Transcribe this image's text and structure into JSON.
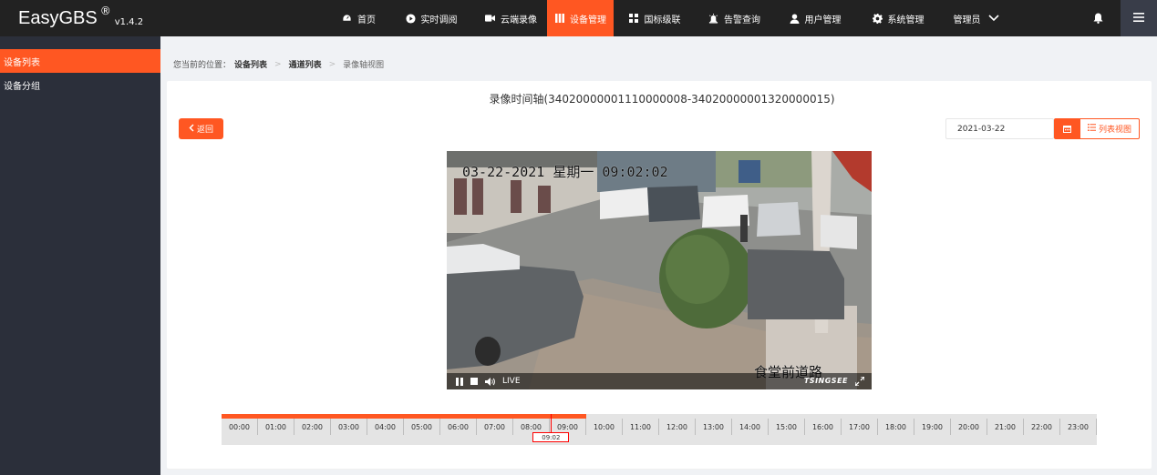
{
  "app": {
    "name": "EasyGBS",
    "reg": "®",
    "version": "v1.4.2"
  },
  "nav": [
    {
      "label": "首页",
      "icon": "dashboard-icon",
      "active": false
    },
    {
      "label": "实时调阅",
      "icon": "play-circle-icon",
      "active": false
    },
    {
      "label": "云端录像",
      "icon": "video-camera-icon",
      "active": false
    },
    {
      "label": "设备管理",
      "icon": "columns-icon",
      "active": true
    },
    {
      "label": "国标级联",
      "icon": "grid-icon",
      "active": false
    },
    {
      "label": "告警查询",
      "icon": "alarm-icon",
      "active": false
    },
    {
      "label": "用户管理",
      "icon": "user-icon",
      "active": false
    },
    {
      "label": "系统管理",
      "icon": "gear-icon",
      "active": false
    }
  ],
  "user": {
    "label": "管理员"
  },
  "sidebar": {
    "items": [
      {
        "label": "设备列表",
        "active": true
      },
      {
        "label": "设备分组",
        "active": false
      }
    ]
  },
  "breadcrumb": {
    "prefix": "您当前的位置：",
    "items": [
      "设备列表",
      "通道列表",
      "录像轴视图"
    ]
  },
  "page": {
    "title": "录像时间轴(34020000001110000008-34020000001320000015)"
  },
  "toolbar": {
    "back_label": "返回",
    "date_value": "2021-03-22",
    "list_view_label": "列表视图"
  },
  "video": {
    "osd_time": "03-22-2021 星期一 09:02:02",
    "osd_place": "食堂前道路",
    "live_label": "LIVE",
    "brand_logo": "TSINGSEE"
  },
  "timeline": {
    "hours": [
      "00:00",
      "01:00",
      "02:00",
      "03:00",
      "04:00",
      "05:00",
      "06:00",
      "07:00",
      "08:00",
      "09:00",
      "10:00",
      "11:00",
      "12:00",
      "13:00",
      "14:00",
      "15:00",
      "16:00",
      "17:00",
      "18:00",
      "19:00",
      "20:00",
      "21:00",
      "22:00",
      "23:00"
    ],
    "recorded_fraction": 0.4167,
    "cursor_fraction": 0.3764,
    "cursor_label": "09:02"
  },
  "colors": {
    "accent": "#ff5722",
    "topbar": "#222222",
    "sidebar": "#2b2f3a"
  }
}
